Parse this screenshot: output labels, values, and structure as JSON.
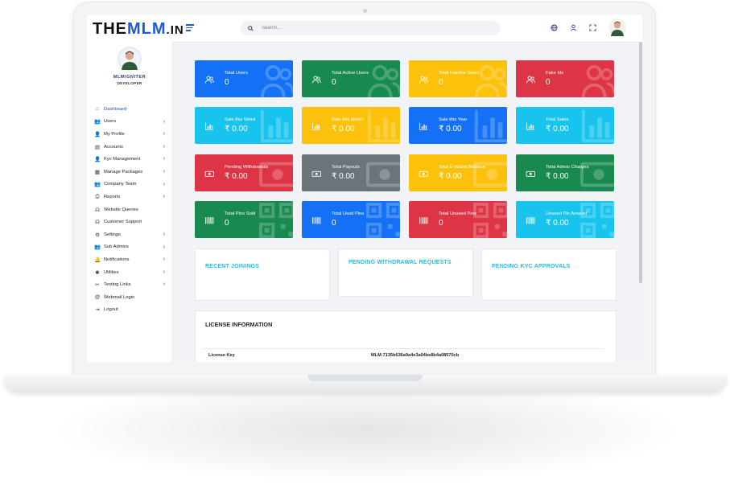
{
  "app": {
    "logo": {
      "prefix": "The",
      "mid": "MLM",
      "suffix": ".in"
    },
    "search": {
      "placeholder": "Search..."
    },
    "colors": {
      "accent": "#2e49c4",
      "cyan": "#1ec0e6"
    }
  },
  "sidebar": {
    "user_name": "MLMIGNITER",
    "user_role": "DEVELOPER",
    "items": [
      {
        "label": "Dashboard",
        "icon": "home-icon",
        "glyph": "⌂",
        "chevron": false,
        "active": true
      },
      {
        "label": "Users",
        "icon": "users-icon",
        "glyph": "👥",
        "chevron": true
      },
      {
        "label": "My Profile",
        "icon": "user-icon",
        "glyph": "👤",
        "chevron": true
      },
      {
        "label": "Accounts",
        "icon": "money-icon",
        "glyph": "▤",
        "chevron": true
      },
      {
        "label": "Kyc Management",
        "icon": "user-check-icon",
        "glyph": "👤",
        "chevron": true
      },
      {
        "label": "Manage Packages",
        "icon": "grid-icon",
        "glyph": "▦",
        "chevron": true
      },
      {
        "label": "Company Team",
        "icon": "team-icon",
        "glyph": "👥",
        "chevron": true
      },
      {
        "label": "Reports",
        "icon": "print-icon",
        "glyph": "⎙",
        "chevron": true
      },
      {
        "label": "Website Queries",
        "icon": "headset-icon",
        "glyph": "☊",
        "chevron": false
      },
      {
        "label": "Customer Support",
        "icon": "headphones-icon",
        "glyph": "☊",
        "chevron": false
      },
      {
        "label": "Settings",
        "icon": "cogs-icon",
        "glyph": "⚙",
        "chevron": true
      },
      {
        "label": "Sub Admins",
        "icon": "user-group-icon",
        "glyph": "👥",
        "chevron": true
      },
      {
        "label": "Notifications",
        "icon": "bell-icon",
        "glyph": "🔔",
        "chevron": true
      },
      {
        "label": "Utilities",
        "icon": "puzzle-icon",
        "glyph": "✱",
        "chevron": true
      },
      {
        "label": "Testing Links",
        "icon": "link-icon",
        "glyph": "✂",
        "chevron": true
      },
      {
        "label": "Webmail Login",
        "icon": "at-icon",
        "glyph": "@",
        "chevron": false
      },
      {
        "label": "Logout",
        "icon": "logout-icon",
        "glyph": "⇥",
        "chevron": false
      }
    ]
  },
  "cards": [
    {
      "label": "Total Users",
      "value": "0",
      "color": "blue",
      "icon": "users-icon"
    },
    {
      "label": "Total Active Users",
      "value": "0",
      "color": "green",
      "icon": "users-icon"
    },
    {
      "label": "Total Inactive Users",
      "value": "0",
      "color": "yellow",
      "icon": "users-icon"
    },
    {
      "label": "Fake Ids",
      "value": "0",
      "color": "red",
      "icon": "users-icon"
    },
    {
      "label": "Sale this Week",
      "value": "₹ 0.00",
      "color": "cyan",
      "icon": "bar-chart-icon"
    },
    {
      "label": "Sale this Month",
      "value": "₹ 0.00",
      "color": "yellow",
      "icon": "bar-chart-icon"
    },
    {
      "label": "Sale this Year",
      "value": "₹ 0.00",
      "color": "blue",
      "icon": "bar-chart-icon"
    },
    {
      "label": "Total Sales",
      "value": "₹ 0.00",
      "color": "cyan",
      "icon": "bar-chart-icon"
    },
    {
      "label": "Pending Withdrawals",
      "value": "₹ 0.00",
      "color": "red",
      "icon": "money-bill-icon"
    },
    {
      "label": "Total Payouts",
      "value": "₹ 0.00",
      "color": "gray",
      "icon": "money-bill-icon"
    },
    {
      "label": "Total E-Wallet Balance",
      "value": "₹ 0.00",
      "color": "yellow",
      "icon": "money-bill-icon"
    },
    {
      "label": "Total Admin Charges",
      "value": "₹ 0.00",
      "color": "green",
      "icon": "money-bill-icon"
    },
    {
      "label": "Total Pins Sold",
      "value": "0",
      "color": "green",
      "icon": "barcode-icon"
    },
    {
      "label": "Total Used Pins",
      "value": "0",
      "color": "blue",
      "icon": "barcode-icon"
    },
    {
      "label": "Total Unused Pins",
      "value": "0",
      "color": "red",
      "icon": "barcode-icon"
    },
    {
      "label": "Unused Pin Amount",
      "value": "₹ 0.00",
      "color": "cyan",
      "icon": "barcode-icon"
    }
  ],
  "panels": {
    "recent_joinings": "RECENT JOININGS",
    "pending_withdrawals": "PENDING WITHDRAWAL REQUESTS",
    "pending_kyc": "PENDING KYC APPROVALS"
  },
  "license": {
    "title": "LICENSE INFORMATION",
    "key_label": "License Key",
    "key_value": "MLM-7135b636a9a4e3a04be8b4a08570cb"
  }
}
